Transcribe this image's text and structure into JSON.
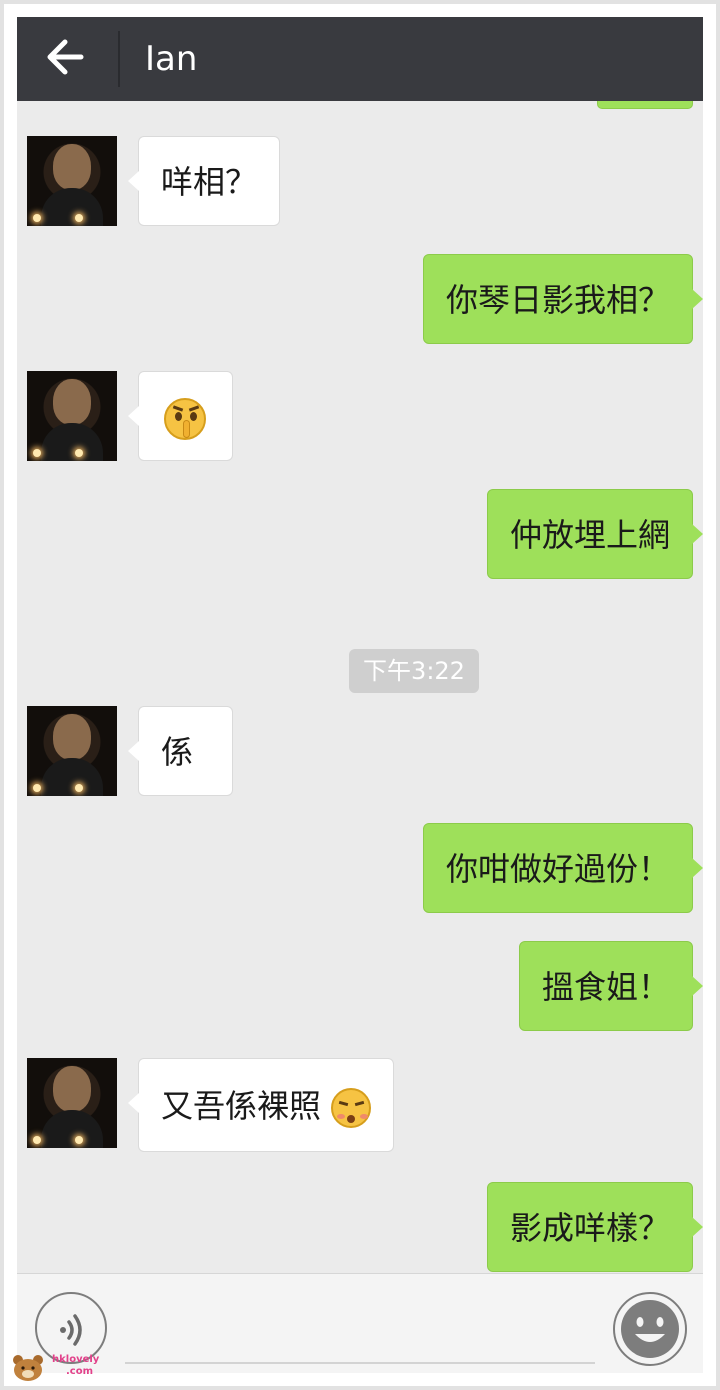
{
  "header": {
    "title": "Ian",
    "back_icon": "arrow-left-icon"
  },
  "messages": [
    {
      "side": "in",
      "text": "咩相？"
    },
    {
      "side": "out",
      "text": "你琴日影我相？"
    },
    {
      "side": "in",
      "text": "",
      "emoji": "shushing-face"
    },
    {
      "side": "out",
      "text": "仲放埋上網"
    },
    {
      "side": "in",
      "text": "係"
    },
    {
      "side": "out",
      "text": "你咁做好過份！"
    },
    {
      "side": "out",
      "text": "搵食姐！"
    },
    {
      "side": "in",
      "text": "又吾係裸照",
      "emoji": "kissing-closed-eyes-face"
    },
    {
      "side": "out",
      "text": "影成咩樣？"
    }
  ],
  "timestamp": "下午3:22",
  "bottom_bar": {
    "voice_icon": "voice-input-icon",
    "emoji_icon": "smiley-face-icon"
  },
  "watermark": {
    "line1": "hklovely",
    "line2": ".com"
  },
  "colors": {
    "header_bg": "#393a3f",
    "chat_bg": "#ebebeb",
    "outgoing_bubble": "#9ee05a",
    "incoming_bubble": "#ffffff",
    "timestamp_bg": "#cfcfcf"
  }
}
